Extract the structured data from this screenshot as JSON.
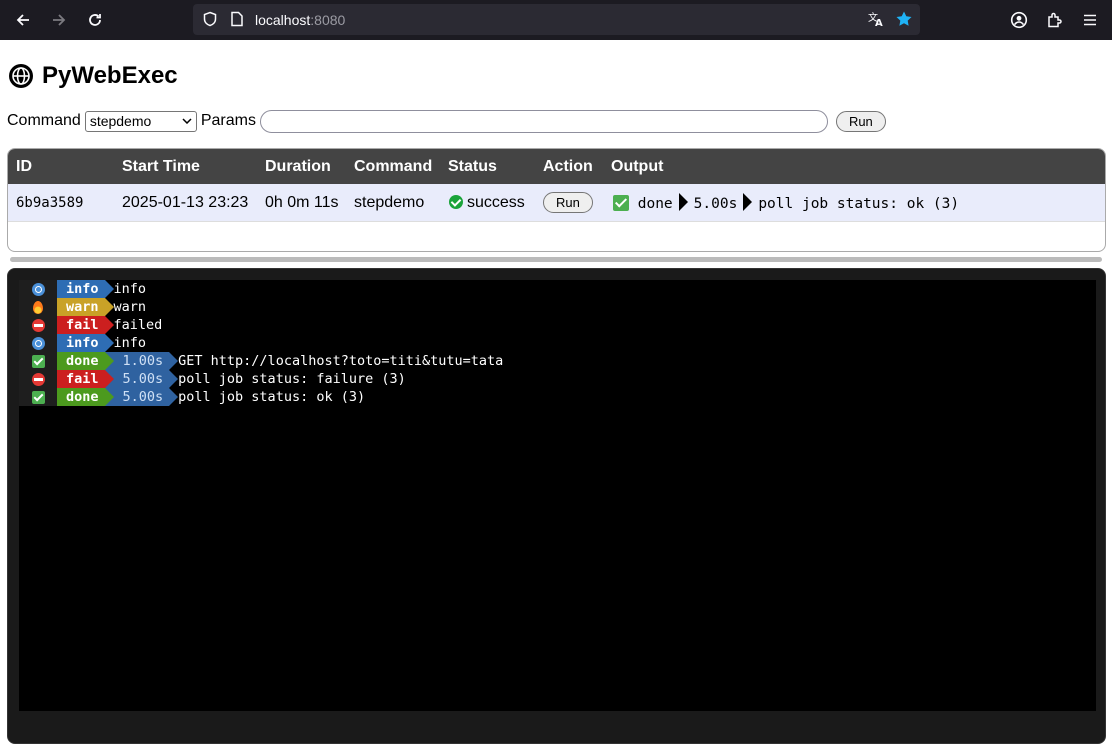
{
  "browser": {
    "url_host": "localhost",
    "url_port": ":8080"
  },
  "app": {
    "title": "PyWebExec"
  },
  "form": {
    "command_label": "Command",
    "command_selected": "stepdemo",
    "params_label": "Params",
    "params_value": "",
    "run_label": "Run"
  },
  "table": {
    "headers": [
      "ID",
      "Start Time",
      "Duration",
      "Command",
      "Status",
      "Action",
      "Output"
    ],
    "rows": [
      {
        "id": "6b9a3589",
        "start_time": "2025-01-13 23:23",
        "duration": "0h 0m 11s",
        "command": "stepdemo",
        "status": "success",
        "action_label": "Run",
        "output": {
          "tag": "done",
          "duration": "5.00s",
          "message": "poll job status: ok (3)"
        }
      }
    ]
  },
  "terminal": {
    "lines": [
      {
        "icon": "info-icon",
        "tag": "info",
        "duration": "",
        "message": "info"
      },
      {
        "icon": "fire-icon",
        "tag": "warn",
        "duration": "",
        "message": "warn"
      },
      {
        "icon": "no-entry-icon",
        "tag": "fail",
        "duration": "",
        "message": "failed"
      },
      {
        "icon": "info-icon",
        "tag": "info",
        "duration": "",
        "message": "info"
      },
      {
        "icon": "check-icon",
        "tag": "done",
        "duration": "1.00s",
        "message": "GET http://localhost?toto=titi&tutu=tata"
      },
      {
        "icon": "no-entry-icon",
        "tag": "fail",
        "duration": "5.00s",
        "message": "poll job status: failure (3)"
      },
      {
        "icon": "check-icon",
        "tag": "done",
        "duration": "5.00s",
        "message": "poll job status: ok (3)"
      }
    ]
  },
  "colors": {
    "info": "#2e6db4",
    "warn": "#c9a227",
    "fail": "#cc1f1f",
    "done": "#4c9a1e",
    "success": "#1aa33a"
  }
}
